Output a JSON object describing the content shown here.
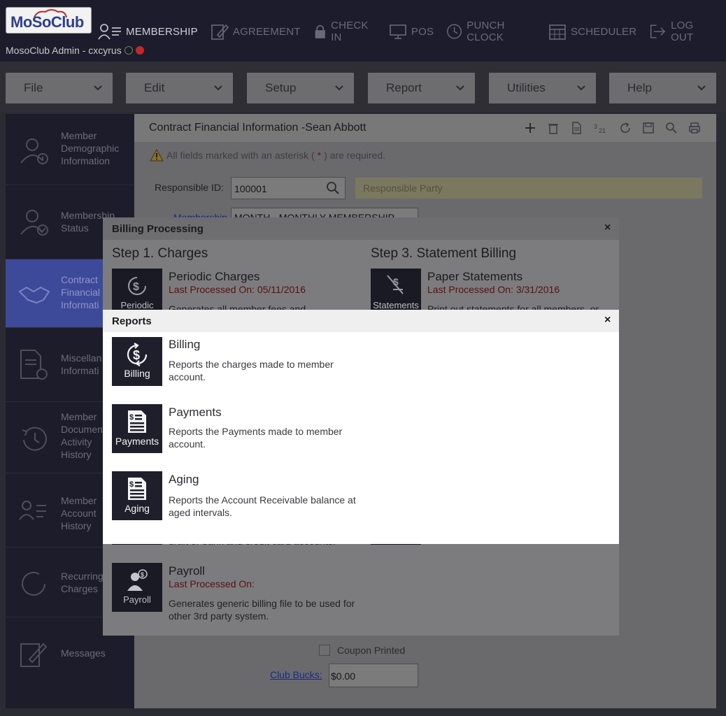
{
  "header": {
    "logo_text": "MoSoClub",
    "admin_line": "MosoClub Admin - cxcyrus",
    "nav": [
      {
        "label": "MEMBERSHIP",
        "icon": "membership-icon"
      },
      {
        "label": "AGREEMENT",
        "icon": "agreement-icon"
      },
      {
        "label": "CHECK IN",
        "icon": "lock-icon"
      },
      {
        "label": "POS",
        "icon": "monitor-icon"
      },
      {
        "label": "PUNCH CLOCK",
        "icon": "clock-icon"
      },
      {
        "label": "SCHEDULER",
        "icon": "calendar-icon"
      },
      {
        "label": "LOG OUT",
        "icon": "logout-icon"
      }
    ]
  },
  "menubar": [
    {
      "label": "File"
    },
    {
      "label": "Edit"
    },
    {
      "label": "Setup"
    },
    {
      "label": "Report"
    },
    {
      "label": "Utilities"
    },
    {
      "label": "Help"
    }
  ],
  "sidebar": [
    {
      "label": "Member\nDemographic\nInformation",
      "icon": "member-info-icon"
    },
    {
      "label": "Membership\nStatus",
      "icon": "member-status-icon"
    },
    {
      "label": "Contract\nFinancial\nInformati",
      "icon": "handshake-icon"
    },
    {
      "label": "Miscellan\nInformati",
      "icon": "document-info-icon"
    },
    {
      "label": "Member\nDocumen\nActivity\nHistory",
      "icon": "history-icon"
    },
    {
      "label": "Member\nAccount\nHistory",
      "icon": "account-history-icon"
    },
    {
      "label": "Recurring\nCharges",
      "icon": "recurring-icon"
    },
    {
      "label": "Messages",
      "icon": "messages-icon"
    }
  ],
  "main": {
    "title": "Contract Financial Information -Sean Abbott",
    "required_note_pre": "All fields marked with an asterisk (",
    "required_note_ast": "*",
    "required_note_post": ") are required.",
    "responsible_id_label": "Responsible ID:",
    "responsible_id_value": "100001",
    "responsible_party_placeholder": "Responsible Party",
    "membership_label": "Membership",
    "membership_value": "MONTH - MONTHLY MEMBERSHIP",
    "coupon_label": "Coupon Printed",
    "club_bucks_label": "Club Bucks:",
    "club_bucks_value": "$0.00"
  },
  "billing_modal": {
    "title": "Billing Processing",
    "close": "×",
    "step1_title": "Step 1. Charges",
    "step3_title": "Step 3. Statement Billing",
    "periodic": {
      "tile_label": "Periodic",
      "name": "Periodic Charges",
      "date": "Last Processed On: 05/11/2016",
      "desc": "Generates all member fees and"
    },
    "statements": {
      "tile_label": "Statements",
      "name": "Paper Statements",
      "date": "Last Processed On: 3/31/2016",
      "desc": "Print out statements for all members, or"
    },
    "eft_desc_tail": "draft or bank and credit card accounts.",
    "payroll": {
      "tile_label": "Payroll",
      "name": "Payroll",
      "date": "Last Processed On:",
      "desc": "Generates generic billing file to be used for other 3rd party system."
    }
  },
  "reports_modal": {
    "title": "Reports",
    "close": "×",
    "items": [
      {
        "tile_label": "Billing",
        "name": "Billing",
        "desc": "Reports the charges made to member account."
      },
      {
        "tile_label": "Payments",
        "name": "Payments",
        "desc": "Reports the Payments made to member account."
      },
      {
        "tile_label": "Aging",
        "name": "Aging",
        "desc": "Reports the Account Receivable balance at aged intervals."
      }
    ]
  },
  "colors": {
    "header_bg": "#1c1c2c",
    "sidebar_active": "#3d4a9a",
    "tile_bg": "#1f1f2c",
    "date_red": "#5a1010"
  }
}
